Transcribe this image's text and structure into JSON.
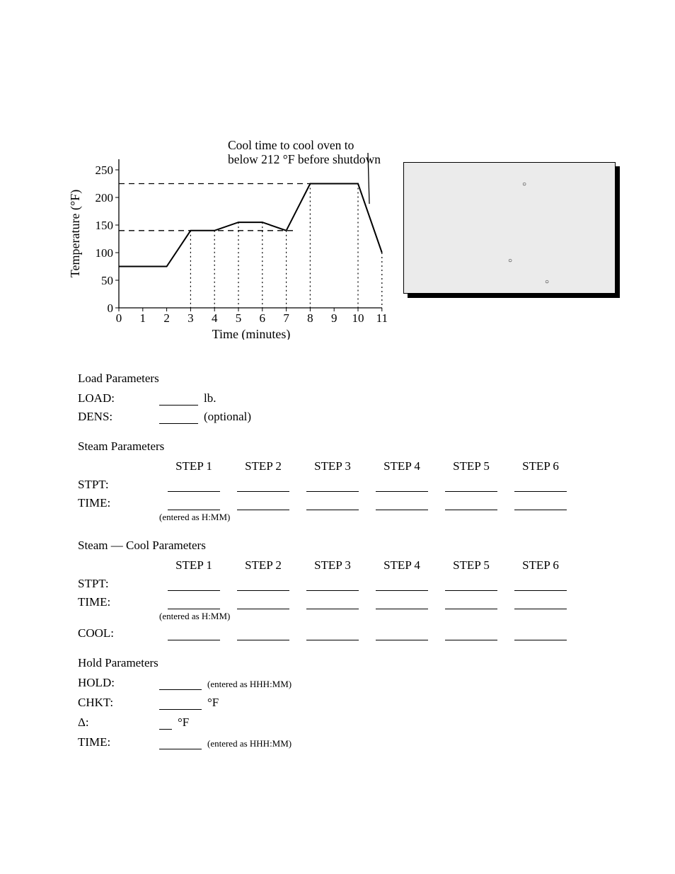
{
  "chart_data": {
    "type": "line",
    "title": "",
    "xlabel": "Time (minutes)",
    "ylabel": "Temperature (°F)",
    "caption": "Cool time to cool oven to\nbelow 212 °F before shutdown",
    "xlim": [
      0,
      11
    ],
    "ylim": [
      0,
      260
    ],
    "x_ticks": [
      0,
      1,
      2,
      3,
      4,
      5,
      6,
      7,
      8,
      9,
      10,
      11
    ],
    "y_ticks": [
      0,
      50,
      100,
      150,
      200,
      250
    ],
    "x": [
      0,
      2,
      3,
      4,
      5,
      6,
      7,
      8,
      10,
      11
    ],
    "y": [
      75,
      75,
      140,
      140,
      155,
      155,
      140,
      225,
      225,
      100
    ],
    "dashed_reference_y": [
      140,
      225
    ],
    "dotted_drops_x": [
      3,
      4,
      5,
      6,
      7,
      8,
      10,
      11
    ]
  },
  "sections": {
    "load": {
      "title": "Load Parameters",
      "load_label": "LOAD:",
      "load_after": "lb.",
      "dens_label": "DENS:",
      "dens_after": "(optional)"
    },
    "steam": {
      "title": "Steam Parameters",
      "step_header": "STEP",
      "steps": [
        1,
        2,
        3,
        4,
        5,
        6
      ],
      "stpt_label": "STPT:",
      "time_label": "TIME:",
      "subnote": "(entered as H:MM)"
    },
    "steam_cool": {
      "title": "Steam — Cool Parameters",
      "step_header": "STEP",
      "steps": [
        1,
        2,
        3,
        4,
        5,
        6
      ],
      "stpt_label": "STPT:",
      "time_label": "TIME:",
      "subnote": "(entered as H:MM)",
      "cool_label": "COOL:"
    },
    "hold": {
      "title": "Hold Parameters",
      "hold_label": "HOLD:",
      "hold_after": "(entered as HHH:MM)",
      "chkt_label": "CHKT:",
      "chkt_after": "°F",
      "delta_label": "Δ:",
      "delta_after": "°F",
      "time_label": "TIME:",
      "time_after": "(entered as HHH:MM)"
    }
  }
}
